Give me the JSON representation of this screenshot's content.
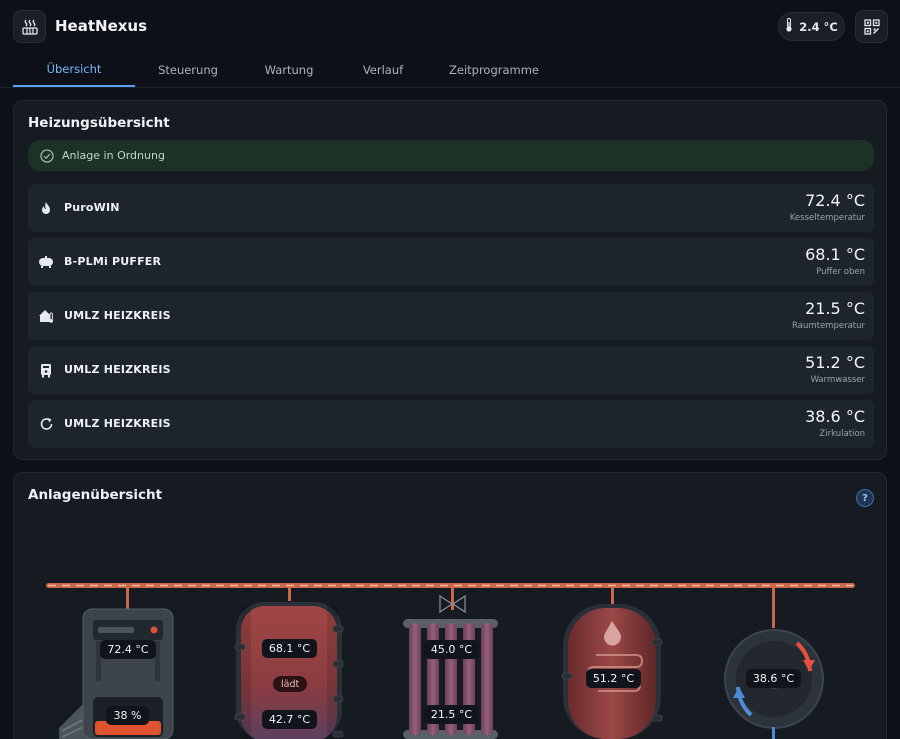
{
  "app": {
    "title": "HeatNexus",
    "outdoor_temp": "2.4 °C"
  },
  "tabs": [
    {
      "label": "Übersicht",
      "active": true
    },
    {
      "label": "Steuerung",
      "active": false
    },
    {
      "label": "Wartung",
      "active": false
    },
    {
      "label": "Verlauf",
      "active": false
    },
    {
      "label": "Zeitprogramme",
      "active": false
    }
  ],
  "overview": {
    "title": "Heizungsübersicht",
    "status": "Anlage in Ordnung",
    "rows": [
      {
        "icon": "flame-icon",
        "name": "PuroWIN",
        "value": "72.4 °C",
        "sub": "Kesseltemperatur"
      },
      {
        "icon": "tank-icon",
        "name": "B-PLMi PUFFER",
        "value": "68.1 °C",
        "sub": "Puffer oben"
      },
      {
        "icon": "house-thermometer-icon",
        "name": "UMLZ HEIZKREIS",
        "value": "21.5 °C",
        "sub": "Raumtemperatur"
      },
      {
        "icon": "water-heater-icon",
        "name": "UMLZ HEIZKREIS",
        "value": "51.2 °C",
        "sub": "Warmwasser"
      },
      {
        "icon": "circulation-icon",
        "name": "UMLZ HEIZKREIS",
        "value": "38.6 °C",
        "sub": "Zirkulation"
      }
    ]
  },
  "plant": {
    "title": "Anlagenübersicht",
    "help": "?",
    "boiler": {
      "temp": "72.4 °C",
      "level": "38 %",
      "level_fraction": 0.38
    },
    "buffer": {
      "top": "68.1 °C",
      "state": "lädt",
      "bottom": "42.7 °C"
    },
    "radiator": {
      "flow": "45.0 °C",
      "room": "21.5 °C"
    },
    "hot_water": {
      "temp": "51.2 °C"
    },
    "circulation": {
      "temp": "38.6 °C"
    }
  },
  "colors": {
    "accent": "#5a9ef5",
    "ok": "#1d3226",
    "pipe": "#c96a4f",
    "tank": "#8c3a3a"
  }
}
